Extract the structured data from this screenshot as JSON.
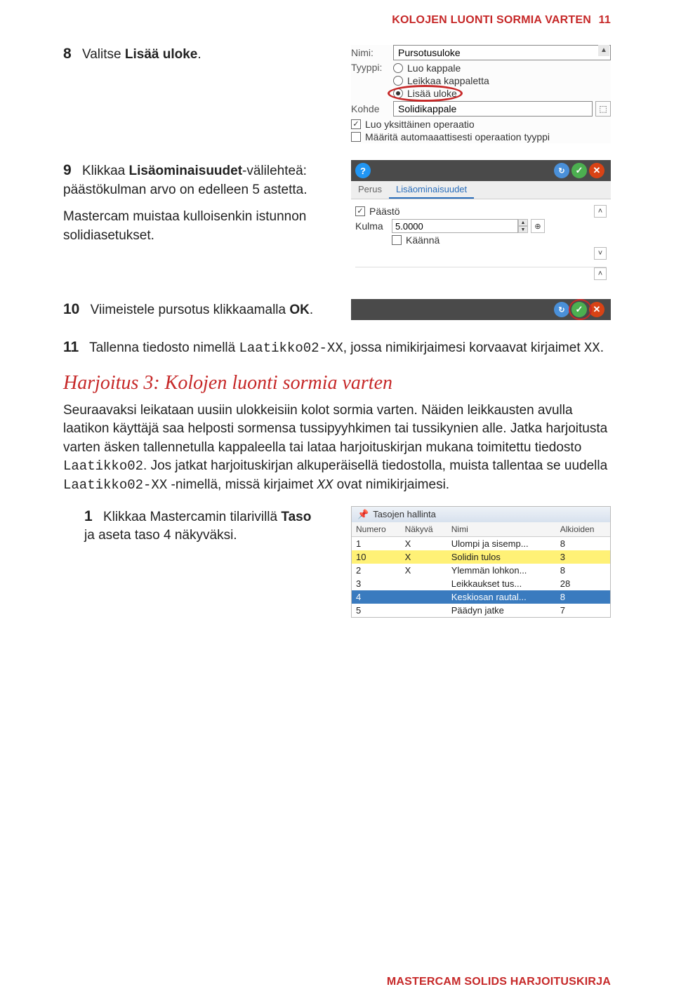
{
  "header": {
    "title": "KOLOJEN LUONTI SORMIA VARTEN",
    "page": "11"
  },
  "step8": {
    "num": "8",
    "text_a": "Valitse ",
    "text_b": "Lisää uloke",
    "text_c": "."
  },
  "panel1": {
    "nimi_label": "Nimi:",
    "nimi_value": "Pursotusuloke",
    "tyyppi_label": "Tyyppi:",
    "opt1": "Luo kappale",
    "opt2": "Leikkaa kappaletta",
    "opt3": "Lisää uloke",
    "kohde_label": "Kohde",
    "kohde_value": "Solidikappale",
    "chk1": "Luo yksittäinen operaatio",
    "chk2": "Määritä automaaattisesti operaation tyyppi"
  },
  "step9": {
    "num": "9",
    "text_a": "Klikkaa ",
    "text_b": "Lisäominaisuudet",
    "text_c": "-välilehteä: päästökulman arvo on edelleen 5 astetta.",
    "text_d": "Mastercam muistaa kulloisenkin istunnon solidiasetukset."
  },
  "panel2": {
    "tab1": "Perus",
    "tab2": "Lisäominaisuudet",
    "paasto": "Päästö",
    "kulma_label": "Kulma",
    "kulma_value": "5.0000",
    "kaanna": "Käännä"
  },
  "step10": {
    "num": "10",
    "text_a": "Viimeistele pursotus klikkaamalla ",
    "text_b": "OK",
    "text_c": "."
  },
  "step11": {
    "num": "11",
    "text_a": "Tallenna tiedosto nimellä ",
    "code_a": "Laatikko02-XX",
    "text_b": ", jossa nimikirjaimesi korvaavat kirjaimet ",
    "code_b": "XX",
    "text_c": "."
  },
  "section": {
    "title": "Harjoitus 3: Kolojen luonti sormia varten",
    "p_a": "Seuraavaksi leikataan uusiin ulokkeisiin kolot sormia varten. Näiden leikkausten avulla laatikon käyttäjä saa helposti sormensa tussipyyhkimen tai tussikynien alle. Jatka harjoitusta varten äsken tallennetulla kappaleella tai lataa harjoituskirjan mukana toimitettu tiedosto ",
    "code_a": "Laatikko02",
    "p_b": ". Jos jatkat harjoituskirjan alkuperäisellä tiedostolla, muista tallentaa se uudella ",
    "code_b": "Laatikko02-XX",
    "p_c": " -nimellä, missä kirjaimet ",
    "code_c": "XX",
    "p_d": " ovat nimikirjaimesi."
  },
  "step1b": {
    "num": "1",
    "text_a": "Klikkaa Mastercamin tilarivillä ",
    "text_b": "Taso",
    "text_c": " ja aseta taso 4 näkyväksi."
  },
  "panel4": {
    "title": "Tasojen hallinta",
    "cols": [
      "Numero",
      "Näkyvä",
      "Nimi",
      "Alkioiden"
    ],
    "rows": [
      {
        "num": "1",
        "vis": "X",
        "name": "Ulompi ja sisemp...",
        "cnt": "8",
        "cls": ""
      },
      {
        "num": "10",
        "vis": "X",
        "name": "Solidin tulos",
        "cnt": "3",
        "cls": "yellow"
      },
      {
        "num": "2",
        "vis": "X",
        "name": "Ylemmän lohkon...",
        "cnt": "8",
        "cls": ""
      },
      {
        "num": "3",
        "vis": "",
        "name": "Leikkaukset tus...",
        "cnt": "28",
        "cls": ""
      },
      {
        "num": "4",
        "vis": "",
        "name": "Keskiosan rautal...",
        "cnt": "8",
        "cls": "blue"
      },
      {
        "num": "5",
        "vis": "",
        "name": "Päädyn jatke",
        "cnt": "7",
        "cls": ""
      }
    ]
  },
  "footer": "MASTERCAM SOLIDS HARJOITUSKIRJA"
}
